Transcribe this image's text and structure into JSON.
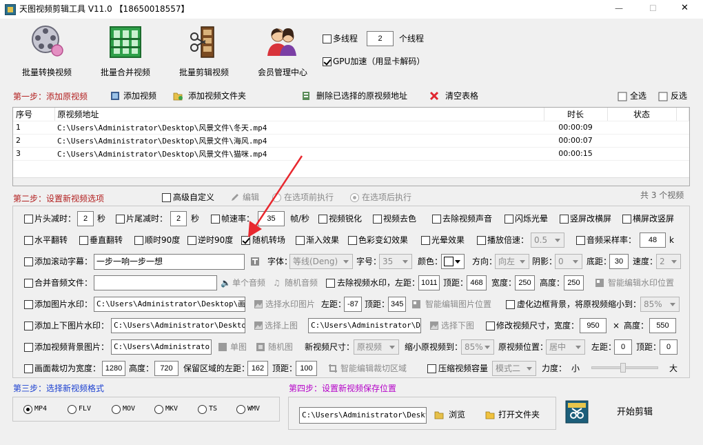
{
  "window": {
    "title": "天图视频剪辑工具 V11.0  【18650018557】",
    "controls": {
      "minimize": "—",
      "maximize": "☐",
      "close": "✕"
    }
  },
  "toolbar": {
    "batch_convert": "批量转换视频",
    "batch_merge": "批量合并视频",
    "batch_cut": "批量剪辑视频",
    "member_center": "会员管理中心",
    "multithread_label": "多线程",
    "thread_count": "2",
    "thread_unit": "个线程",
    "gpu_label": "GPU加速（用显卡解码）"
  },
  "step1": {
    "title": "第一步：添加原视频",
    "add_video": "添加视频",
    "add_folder": "添加视频文件夹",
    "delete_selected": "删除已选择的原视频地址",
    "clear_table": "清空表格",
    "select_all": "全选",
    "invert": "反选"
  },
  "table": {
    "headers": {
      "index": "序号",
      "path": "原视频地址",
      "duration": "时长",
      "status": "状态"
    },
    "rows": [
      {
        "index": "1",
        "path": "C:\\Users\\Administrator\\Desktop\\风景文件\\冬天.mp4",
        "duration": "00:00:09",
        "status": ""
      },
      {
        "index": "2",
        "path": "C:\\Users\\Administrator\\Desktop\\风景文件\\海风.mp4",
        "duration": "00:00:07",
        "status": ""
      },
      {
        "index": "3",
        "path": "C:\\Users\\Administrator\\Desktop\\风景文件\\猫咪.mp4",
        "duration": "00:00:15",
        "status": ""
      }
    ],
    "count_text": "共 3 个视频"
  },
  "step2": {
    "title": "第二步：设置新视频选项",
    "advanced_custom": "高级自定义",
    "edit": "编辑",
    "before_exec": "在选项前执行",
    "after_exec": "在选项后执行",
    "row1": {
      "head_cut": "片头减时：",
      "head_val": "2",
      "sec1": "秒",
      "tail_cut": "片尾减时：",
      "tail_val": "2",
      "sec2": "秒",
      "fps_cut": "帧速率：",
      "fps_val": "35",
      "fps_unit": "帧/秒",
      "sharpen": "视频锐化",
      "desaturate": "视频去色",
      "remove_audio": "去除视频声音",
      "flash": "闪烁光晕",
      "v2h": "竖屏改横屏",
      "h2v": "横屏改竖屏"
    },
    "row2": {
      "hflip": "水平翻转",
      "vflip": "垂直翻转",
      "rot90": "顺时90度",
      "rot_ccw90": "逆时90度",
      "random_transition": "随机转场",
      "fade_in": "渐入效果",
      "color_fx": "色彩变幻效果",
      "light_fx": "光晕效果",
      "speed": "播放倍速：",
      "speed_val": "0.5",
      "sample_rate": "音频采样率：",
      "sample_val": "48",
      "sample_unit": "k"
    },
    "row3": {
      "scroll_sub": "添加滚动字幕：",
      "sub_text": "一步一响一步一想",
      "font_label": "字体：",
      "font_val": "等线(Deng)",
      "size_label": "字号：",
      "size_val": "35",
      "color_label": "颜色：",
      "dir_label": "方向：",
      "dir_val": "向左",
      "shadow_label": "阴影：",
      "shadow_val": "0",
      "bottom_label": "底距：",
      "bottom_val": "30",
      "speed_label": "速度：",
      "speed_val": "2"
    },
    "row4": {
      "merge_audio": "合并音频文件：",
      "single_audio": "单个音频",
      "random_audio": "随机音频",
      "remove_watermark": "去除视频水印，左距：",
      "left_val": "1011",
      "top_label": "顶距：",
      "top_val": "468",
      "width_label": "宽度：",
      "width_val": "250",
      "height_label": "高度：",
      "height_val": "250",
      "smart_edit": "智能编辑水印位置"
    },
    "row5": {
      "img_watermark": "添加图片水印：",
      "img_path": "C:\\Users\\Administrator\\Desktop\\画中画",
      "choose_img": "选择水印图片",
      "left_label": "左距：",
      "left_val": "-87",
      "top_label": "顶距：",
      "top_val": "345",
      "smart_img": "智能编辑图片位置",
      "blur_border": "虚化边框背景，将原视频缩小到：",
      "blur_val": "85%"
    },
    "row6": {
      "tb_watermark": "添加上下图片水印：",
      "top_path": "C:\\Users\\Administrator\\Desktop\\A",
      "choose_top": "选择上图",
      "bottom_path": "C:\\Users\\Administrator\\Desk",
      "choose_bottom": "选择下图",
      "resize": "修改视频尺寸，宽度：",
      "w_val": "950",
      "times": "×",
      "h_label": "高度：",
      "h_val": "550"
    },
    "row7": {
      "bg_img": "添加视频背景图片：",
      "bg_path": "C:\\Users\\Administrator\\D",
      "single_img": "单图",
      "random_img": "随机图",
      "new_size": "新视频尺寸：",
      "new_size_val": "原视频",
      "shrink": "缩小原视频到：",
      "shrink_val": "85%",
      "position": "原视频位置：",
      "position_val": "居中",
      "left_label": "左距：",
      "left_val": "0",
      "top_label": "顶距：",
      "top_val": "0"
    },
    "row8": {
      "crop": "画面裁切为宽度：",
      "crop_w": "1280",
      "h_label": "高度：",
      "crop_h": "720",
      "keep_left": "保留区域的左距：",
      "left_val": "162",
      "top_label": "顶距：",
      "top_val": "100",
      "smart_crop": "智能编辑裁切区域",
      "compress": "压缩视频容量",
      "mode_val": "模式二",
      "strength": "力度：",
      "small": "小",
      "big": "大"
    }
  },
  "step3": {
    "title": "第三步：选择新视频格式",
    "formats": [
      "MP4",
      "FLV",
      "MOV",
      "MKV",
      "TS",
      "WMV"
    ]
  },
  "step4": {
    "title": "第四步：设置新视频保存位置",
    "path": "C:\\Users\\Administrator\\Desktop\\",
    "browse": "浏览",
    "open_folder": "打开文件夹",
    "start": "开始剪辑"
  },
  "colors": {
    "step_title": "#b21f1f",
    "step3_title": "#1a3fd0",
    "step4_title": "#b400c8",
    "arrow": "#e8282f"
  }
}
